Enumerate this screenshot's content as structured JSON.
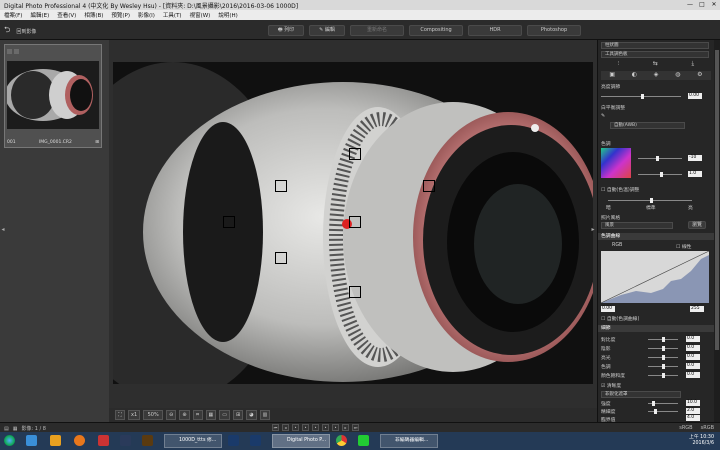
{
  "window": {
    "title": "Digital Photo Professional 4 (中文化 By Wesley Hsu) - [資料夾: D:\\風景攝影\\2016\\2016-03-06 1000D]",
    "controls": [
      "—",
      "□",
      "✕"
    ]
  },
  "menu": [
    "檔案(F)",
    "編輯(E)",
    "查看(V)",
    "相簿(B)",
    "預覽(P)",
    "影像(I)",
    "工具(T)",
    "視窗(W)",
    "說明(H)"
  ],
  "toolbar": {
    "back_label": "回到影像",
    "print_label": "列印",
    "select_label": "編輯",
    "center_buttons": [
      "重新命名",
      "Compositing",
      "HDR",
      "Photoshop"
    ]
  },
  "filmstrip": {
    "thumb_name": "IMG_0001.CR2",
    "thumb_index": "001"
  },
  "viewer_bar": {
    "zoom_x1": "x1",
    "zoom_pct": "50%"
  },
  "status": {
    "selection": "影像: 1 / 8",
    "right_a": "sRGB",
    "right_b": "sRGB"
  },
  "panel": {
    "header": "柱狀圖",
    "dropdown_top": "工具調色板",
    "exposure_label": "亮度調節",
    "exposure_value": "0.00",
    "wb_label": "白平衡調整",
    "wb_value": "自動(AWB)",
    "color_label": "色調",
    "color_val_a": "-10",
    "color_val_b": "1.0",
    "auto_balance": "自動(色溫)調整",
    "tone_left": "暗",
    "tone_mid": "標準",
    "tone_right": "亮",
    "picture_style_label": "照片風格",
    "picture_style_value": "風景",
    "apply_button": "瀏覽",
    "curve_label": "色調曲線",
    "curve_mode": "RGB",
    "linear_label": "線性",
    "curve_val_l": "0.00",
    "curve_val_r": "255",
    "auto_curve": "自動(色調曲線)",
    "detail_label": "細節",
    "rows": [
      {
        "label": "對比度",
        "value": "0.0"
      },
      {
        "label": "陰影",
        "value": "0.0"
      },
      {
        "label": "亮光",
        "value": "0.0"
      },
      {
        "label": "色調",
        "value": "0.0"
      },
      {
        "label": "顏色飽和度",
        "value": "0.0"
      }
    ],
    "sharpen_check": "清晰度",
    "sharpen_mode": "非銳化遮罩",
    "sharp_rows": [
      {
        "label": "強度",
        "value": "10.0"
      },
      {
        "label": "精細度",
        "value": "2.0"
      },
      {
        "label": "臨界值",
        "value": "4.0"
      }
    ]
  },
  "taskbar": {
    "tasks": [
      "1000D_ttts 修...",
      "Digital Photo P...",
      "非編碼器編輯..."
    ],
    "time": "上午 10:30",
    "date": "2016/3/6"
  }
}
